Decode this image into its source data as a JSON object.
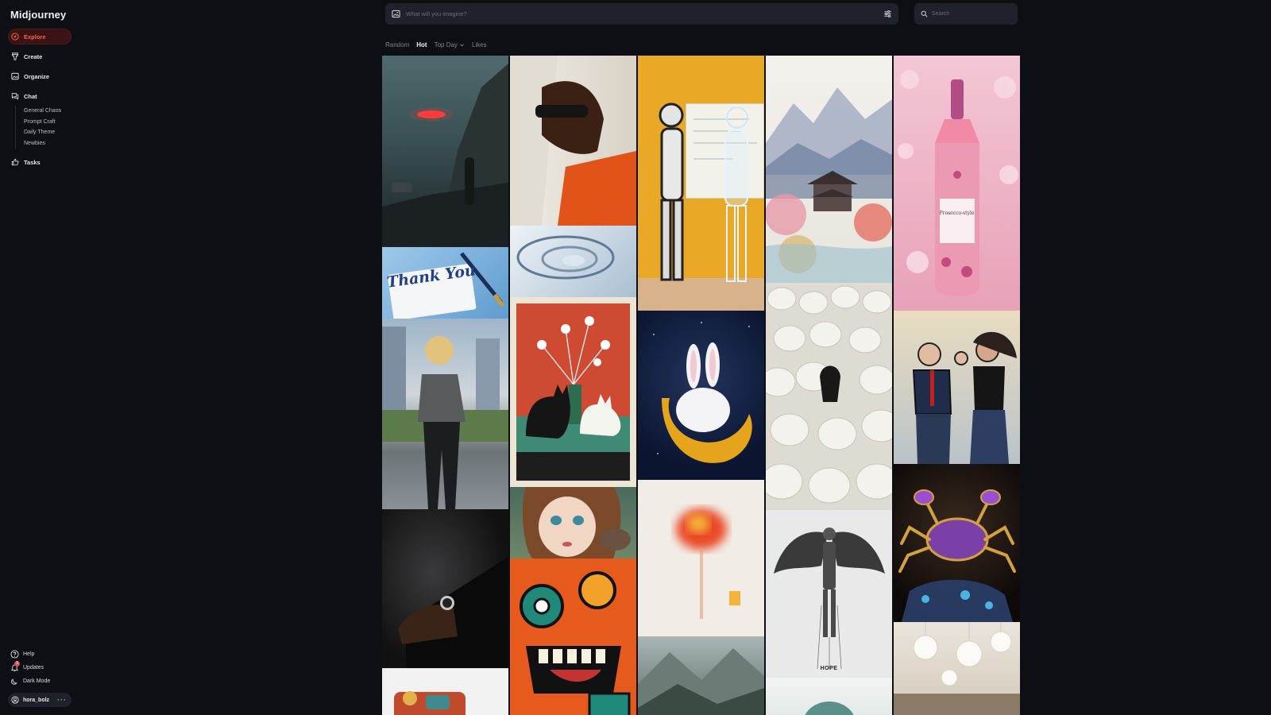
{
  "app": {
    "brand": "Midjourney"
  },
  "sidebar": {
    "items": [
      {
        "label": "Explore",
        "icon": "compass-icon",
        "active": true
      },
      {
        "label": "Create",
        "icon": "brush-icon"
      },
      {
        "label": "Organize",
        "icon": "image-icon"
      },
      {
        "label": "Chat",
        "icon": "chat-icon"
      },
      {
        "label": "Tasks",
        "icon": "thumbs-up-icon"
      }
    ],
    "chat_rooms": [
      "General Chaos",
      "Prompt Craft",
      "Daily Theme",
      "Newbies"
    ],
    "bottom": [
      {
        "label": "Help",
        "icon": "help-icon"
      },
      {
        "label": "Updates",
        "icon": "bell-icon",
        "badge": "3"
      },
      {
        "label": "Dark Mode",
        "icon": "moon-icon"
      }
    ],
    "user": {
      "name": "hora_bolz",
      "menu": "···"
    }
  },
  "imagine": {
    "placeholder": "What will you imagine?"
  },
  "search": {
    "placeholder": "Search"
  },
  "tabs": [
    {
      "label": "Random"
    },
    {
      "label": "Hot",
      "active": true
    },
    {
      "label": "Top Day",
      "dropdown": true
    },
    {
      "label": "Likes"
    }
  ],
  "gallery": {
    "columns": [
      [
        {
          "subject": "red UFO over misty mountain with car"
        },
        {
          "subject": "thank you card with fountain pen",
          "caption": "Thank You"
        },
        {
          "subject": "blonde woman in satin blouse on city street"
        },
        {
          "subject": "hand with wristwatch in dark studio"
        },
        {
          "subject": "colorful toy vehicle"
        }
      ],
      [
        {
          "subject": "motion-blurred runner with sunglasses"
        },
        {
          "subject": "abstract white tunnel"
        },
        {
          "subject": "cats and flower vase illustration"
        },
        {
          "subject": "doll-faced girl with bird"
        },
        {
          "subject": "graffiti monster pattern"
        }
      ],
      [
        {
          "subject": "robot facing hologram human at whiteboard"
        },
        {
          "subject": "fluffy bunny sleeping on crescent moon"
        },
        {
          "subject": "blurred red flower"
        },
        {
          "subject": "misty mountain landscape"
        }
      ],
      [
        {
          "subject": "watercolor mountain pagoda"
        },
        {
          "subject": "herd of white horses with one black horse"
        },
        {
          "subject": "winged mechanical angel sketch",
          "caption": "HOPE"
        },
        {
          "subject": "teal creature"
        }
      ],
      [
        {
          "subject": "rose prosecco bottle with cherry blossoms",
          "caption": "Prosecco-style"
        },
        {
          "subject": "comic fight businessman vs woman"
        },
        {
          "subject": "jeweled crab"
        },
        {
          "subject": "white paper lanterns in cafe"
        }
      ]
    ]
  },
  "colors": {
    "accent": "#ff5a4e",
    "background": "#0d0f14",
    "panel": "#1f222a"
  }
}
